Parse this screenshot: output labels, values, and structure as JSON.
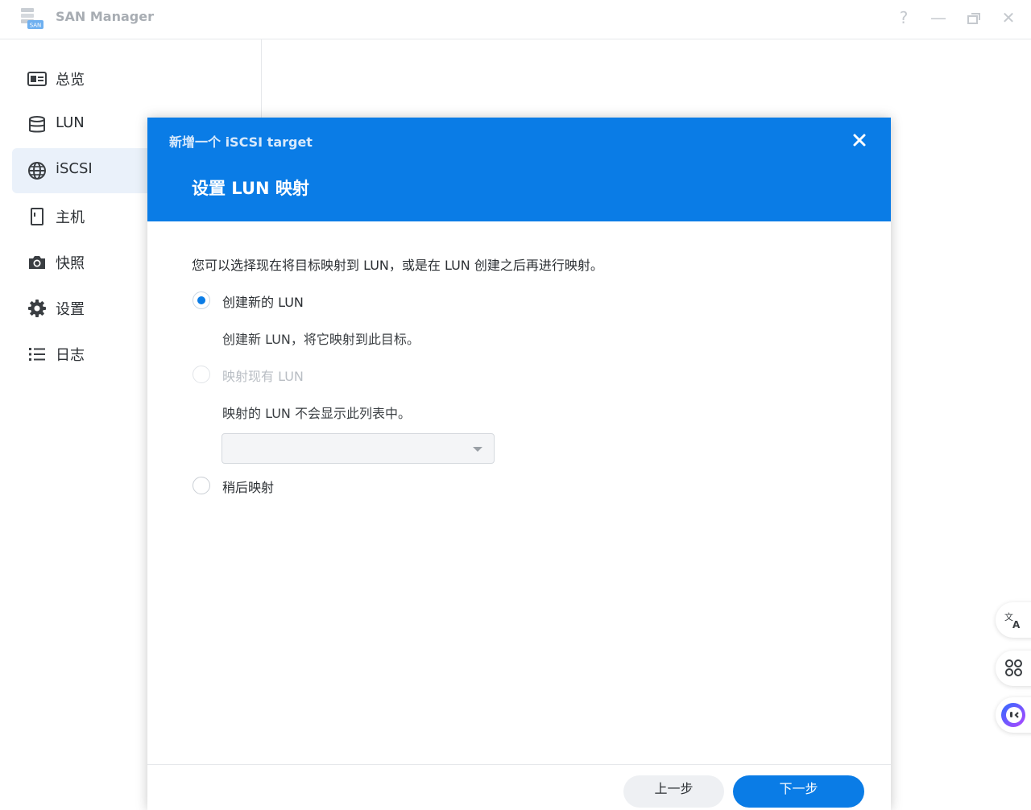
{
  "app": {
    "title": "SAN Manager",
    "logo_text": "SAN"
  },
  "window_controls": {
    "help": "?",
    "minimize": "—",
    "close": "✕"
  },
  "sidebar": {
    "items": [
      {
        "label": "总览",
        "icon": "overview-card-icon"
      },
      {
        "label": "LUN",
        "icon": "database-icon"
      },
      {
        "label": "iSCSI",
        "icon": "globe-icon"
      },
      {
        "label": "主机",
        "icon": "host-icon"
      },
      {
        "label": "快照",
        "icon": "camera-icon"
      },
      {
        "label": "设置",
        "icon": "gear-icon"
      },
      {
        "label": "日志",
        "icon": "list-icon"
      }
    ],
    "active_index": 2
  },
  "dialog": {
    "subtitle": "新增一个 iSCSI target",
    "title": "设置 LUN 映射",
    "intro": "您可以选择现在将目标映射到 LUN，或是在 LUN 创建之后再进行映射。",
    "options": [
      {
        "label": "创建新的 LUN",
        "description": "创建新 LUN，将它映射到此目标。",
        "checked": true,
        "disabled": false
      },
      {
        "label": "映射现有 LUN",
        "description": "映射的 LUN 不会显示此列表中。",
        "checked": false,
        "disabled": true
      },
      {
        "label": "稍后映射",
        "checked": false,
        "disabled": false
      }
    ],
    "lun_select_value": "",
    "buttons": {
      "prev": "上一步",
      "next": "下一步"
    }
  },
  "colors": {
    "accent": "#0a7ce6",
    "sidebar_active_bg": "#eaf1fa"
  },
  "floating_buttons": [
    "translate-icon",
    "apps-grid-icon",
    "assistant-face-icon"
  ]
}
